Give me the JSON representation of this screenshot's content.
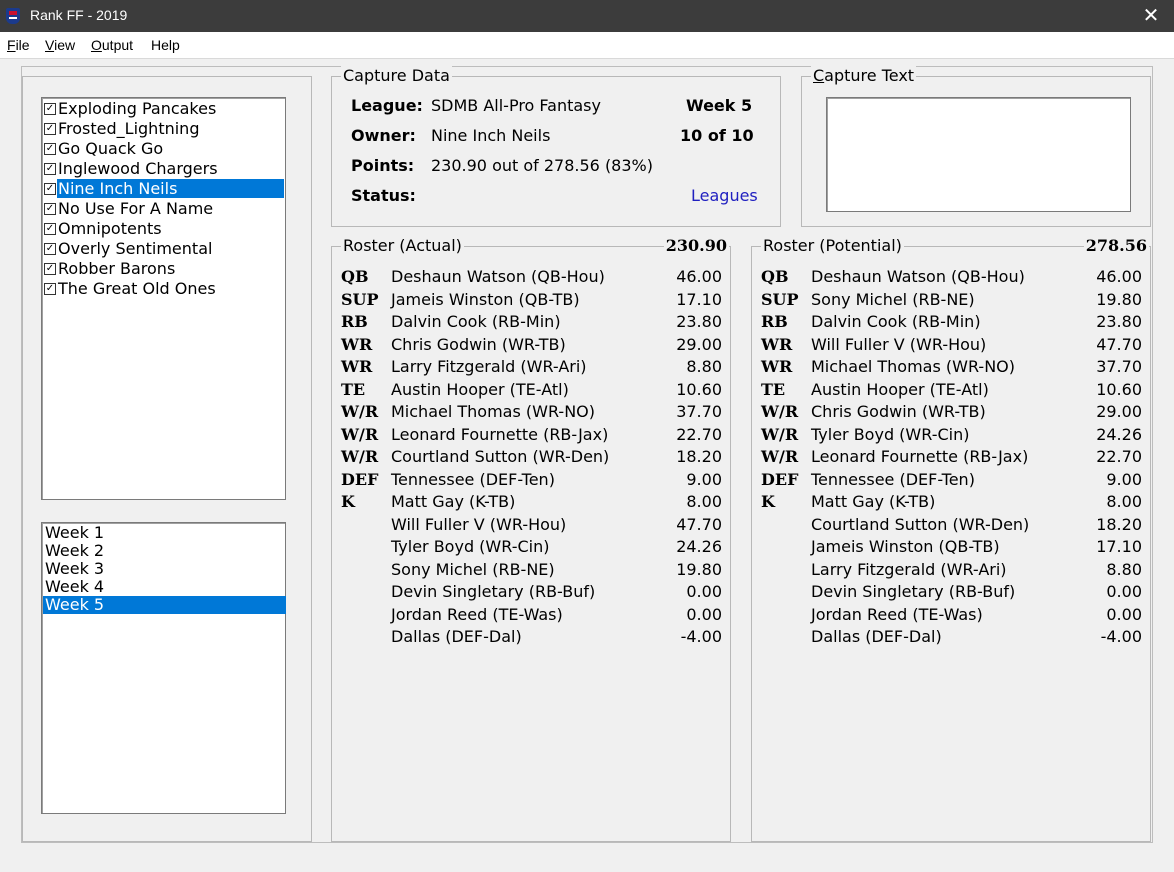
{
  "window": {
    "title": "Rank FF - 2019",
    "icon": "nfl-shield-icon",
    "close_glyph": "✕"
  },
  "menu": {
    "file": {
      "mnemonic": "F",
      "rest": "ile"
    },
    "view": {
      "mnemonic": "V",
      "rest": "iew"
    },
    "output": {
      "mnemonic": "O",
      "rest": "utput"
    },
    "help": {
      "label": "Help"
    }
  },
  "teams": [
    {
      "name": "Exploding Pancakes",
      "checked": true
    },
    {
      "name": "Frosted_Lightning",
      "checked": true
    },
    {
      "name": "Go Quack Go",
      "checked": true
    },
    {
      "name": "Inglewood Chargers",
      "checked": true
    },
    {
      "name": "Nine Inch Neils",
      "checked": true,
      "selected": true
    },
    {
      "name": "No Use For A Name",
      "checked": true
    },
    {
      "name": "Omnipotents",
      "checked": true
    },
    {
      "name": "Overly Sentimental",
      "checked": true
    },
    {
      "name": "Robber Barons",
      "checked": true
    },
    {
      "name": "The Great Old Ones",
      "checked": true
    }
  ],
  "weeks": [
    {
      "name": "Week 1"
    },
    {
      "name": "Week 2"
    },
    {
      "name": "Week 3"
    },
    {
      "name": "Week 4"
    },
    {
      "name": "Week 5",
      "selected": true
    }
  ],
  "capture_data": {
    "legend": "Capture Data",
    "league_label": "League:",
    "league_value": "SDMB All-Pro Fantasy",
    "week": "Week 5",
    "owner_label": "Owner:",
    "owner_value": "Nine Inch Neils",
    "rank": "10 of 10",
    "points_label": "Points:",
    "points_value": "230.90 out of 278.56 (83%)",
    "status_label": "Status:",
    "leagues_link": "Leagues"
  },
  "capture_text": {
    "legend_mnemonic": "C",
    "legend_rest": "apture Text",
    "value": ""
  },
  "roster_actual": {
    "legend": "Roster (Actual)",
    "total": "230.90",
    "rows": [
      {
        "pos": "QB",
        "name": "Deshaun Watson (QB-Hou)",
        "pts": "46.00"
      },
      {
        "pos": "SUP",
        "name": "Jameis Winston (QB-TB)",
        "pts": "17.10"
      },
      {
        "pos": "RB",
        "name": "Dalvin Cook (RB-Min)",
        "pts": "23.80"
      },
      {
        "pos": "WR",
        "name": "Chris Godwin (WR-TB)",
        "pts": "29.00"
      },
      {
        "pos": "WR",
        "name": "Larry Fitzgerald (WR-Ari)",
        "pts": "8.80"
      },
      {
        "pos": "TE",
        "name": "Austin Hooper (TE-Atl)",
        "pts": "10.60"
      },
      {
        "pos": "W/R",
        "name": "Michael Thomas (WR-NO)",
        "pts": "37.70"
      },
      {
        "pos": "W/R",
        "name": "Leonard Fournette (RB-Jax)",
        "pts": "22.70"
      },
      {
        "pos": "W/R",
        "name": "Courtland Sutton (WR-Den)",
        "pts": "18.20"
      },
      {
        "pos": "DEF",
        "name": "Tennessee (DEF-Ten)",
        "pts": "9.00"
      },
      {
        "pos": "K",
        "name": "Matt Gay (K-TB)",
        "pts": "8.00"
      },
      {
        "pos": "",
        "name": "Will Fuller V (WR-Hou)",
        "pts": "47.70"
      },
      {
        "pos": "",
        "name": "Tyler Boyd (WR-Cin)",
        "pts": "24.26"
      },
      {
        "pos": "",
        "name": "Sony Michel (RB-NE)",
        "pts": "19.80"
      },
      {
        "pos": "",
        "name": "Devin Singletary (RB-Buf)",
        "pts": "0.00"
      },
      {
        "pos": "",
        "name": "Jordan Reed (TE-Was)",
        "pts": "0.00"
      },
      {
        "pos": "",
        "name": "Dallas (DEF-Dal)",
        "pts": "-4.00"
      }
    ]
  },
  "roster_potential": {
    "legend": "Roster (Potential)",
    "total": "278.56",
    "rows": [
      {
        "pos": "QB",
        "name": "Deshaun Watson (QB-Hou)",
        "pts": "46.00"
      },
      {
        "pos": "SUP",
        "name": "Sony Michel (RB-NE)",
        "pts": "19.80"
      },
      {
        "pos": "RB",
        "name": "Dalvin Cook (RB-Min)",
        "pts": "23.80"
      },
      {
        "pos": "WR",
        "name": "Will Fuller V (WR-Hou)",
        "pts": "47.70"
      },
      {
        "pos": "WR",
        "name": "Michael Thomas (WR-NO)",
        "pts": "37.70"
      },
      {
        "pos": "TE",
        "name": "Austin Hooper (TE-Atl)",
        "pts": "10.60"
      },
      {
        "pos": "W/R",
        "name": "Chris Godwin (WR-TB)",
        "pts": "29.00"
      },
      {
        "pos": "W/R",
        "name": "Tyler Boyd (WR-Cin)",
        "pts": "24.26"
      },
      {
        "pos": "W/R",
        "name": "Leonard Fournette (RB-Jax)",
        "pts": "22.70"
      },
      {
        "pos": "DEF",
        "name": "Tennessee (DEF-Ten)",
        "pts": "9.00"
      },
      {
        "pos": "K",
        "name": "Matt Gay (K-TB)",
        "pts": "8.00"
      },
      {
        "pos": "",
        "name": "Courtland Sutton (WR-Den)",
        "pts": "18.20"
      },
      {
        "pos": "",
        "name": "Jameis Winston (QB-TB)",
        "pts": "17.10"
      },
      {
        "pos": "",
        "name": "Larry Fitzgerald (WR-Ari)",
        "pts": "8.80"
      },
      {
        "pos": "",
        "name": "Devin Singletary (RB-Buf)",
        "pts": "0.00"
      },
      {
        "pos": "",
        "name": "Jordan Reed (TE-Was)",
        "pts": "0.00"
      },
      {
        "pos": "",
        "name": "Dallas (DEF-Dal)",
        "pts": "-4.00"
      }
    ]
  }
}
